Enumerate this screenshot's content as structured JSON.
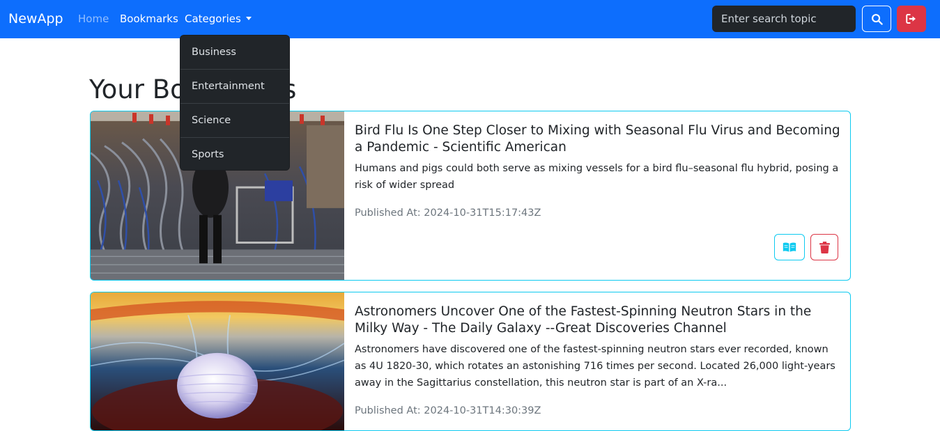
{
  "app": {
    "brand": "NewApp"
  },
  "nav": {
    "home": "Home",
    "bookmarks": "Bookmarks",
    "categories": "Categories"
  },
  "categories_menu": {
    "items": [
      "Business",
      "Entertainment",
      "Science",
      "Sports"
    ]
  },
  "search": {
    "placeholder": "Enter search topic",
    "value": ""
  },
  "icons": {
    "search": "search-icon",
    "logout": "sign-out-icon",
    "read": "book-open-icon",
    "delete": "trash-icon"
  },
  "colors": {
    "navbar": "#0d6efd",
    "danger": "#dc3545",
    "info": "#0dcaf0",
    "dark": "#212529",
    "muted": "#6c757d"
  },
  "page": {
    "title": "Your Bookmarks"
  },
  "bookmarks": [
    {
      "title": "Bird Flu Is One Step Closer to Mixing with Seasonal Flu Virus and Becoming a Pandemic - Scientific American",
      "description": "Humans and pigs could both serve as mixing vessels for a bird flu–seasonal flu hybrid, posing a risk of wider spread",
      "published": "Published At: 2024-10-31T15:17:43Z"
    },
    {
      "title": "Astronomers Uncover One of the Fastest-Spinning Neutron Stars in the Milky Way - The Daily Galaxy --Great Discoveries Channel",
      "description": "Astronomers have discovered one of the fastest-spinning neutron stars ever recorded, known as 4U 1820-30, which rotates an astonishing 716 times per second. Located 26,000 light-years away in the Sagittarius constellation, this neutron star is part of an X-ra...",
      "published": "Published At: 2024-10-31T14:30:39Z"
    }
  ]
}
